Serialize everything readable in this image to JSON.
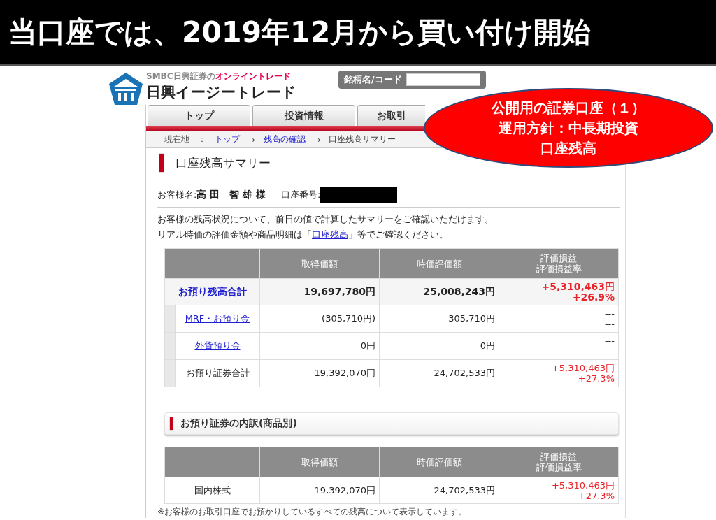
{
  "banner": {
    "title": "当口座では、2019年12月から買い付け開始"
  },
  "header": {
    "tagline_prefix": "SMBC日興証券の",
    "tagline_accent": "オンライントレード",
    "brand": "日興イージートレード",
    "search": {
      "label": "銘柄名/コード"
    }
  },
  "tabs": [
    {
      "label": "トップ"
    },
    {
      "label": "投資情報"
    },
    {
      "label": "お取引"
    }
  ],
  "breadcrumb": {
    "label": "現在地",
    "separator": "：",
    "arrow": "→",
    "items": [
      {
        "text": "トップ",
        "link": true
      },
      {
        "text": "残高の確認",
        "link": true
      },
      {
        "text": "口座残高サマリー",
        "link": false
      }
    ]
  },
  "page_title": "口座残高サマリー",
  "customer": {
    "name_label": "お客様名:",
    "name": "高 田　智 雄 様",
    "account_label": "口座番号:"
  },
  "intro": {
    "line1": "お客様の残高状況について、前日の値で計算したサマリーをご確認いただけます。",
    "line2_before": "リアル時価の評価金額や商品明細は「",
    "line2_link": "口座残高",
    "line2_after": "」等でご確認ください。"
  },
  "summary_table": {
    "columns": [
      [
        "取得価額"
      ],
      [
        "時価評価額"
      ],
      [
        "評価損益",
        "評価損益率"
      ]
    ],
    "rows": [
      {
        "kind": "total",
        "label": "お預り残高合計",
        "link": true,
        "cost": "19,697,780円",
        "value": "25,008,243円",
        "gain": "+5,310,463円",
        "rate": "+26.9%",
        "profit": true
      },
      {
        "kind": "sub",
        "label": "MRF・お預り金",
        "link": true,
        "cost": "(305,710円)",
        "value": "305,710円",
        "gain": "---",
        "rate": "---",
        "profit": false
      },
      {
        "kind": "sub",
        "label": "外貨預り金",
        "link": true,
        "cost": "0円",
        "value": "0円",
        "gain": "---",
        "rate": "---",
        "profit": false
      },
      {
        "kind": "sub",
        "label": "お預り証券合計",
        "link": false,
        "cost": "19,392,070円",
        "value": "24,702,533円",
        "gain": "+5,310,463円",
        "rate": "+27.3%",
        "profit": true
      }
    ]
  },
  "section_title": "お預り証券の内訳(商品別)",
  "breakdown_table": {
    "columns": [
      [
        "取得価額"
      ],
      [
        "時価評価額"
      ],
      [
        "評価損益",
        "評価損益率"
      ]
    ],
    "rows": [
      {
        "kind": "plain",
        "label": "国内株式",
        "link": false,
        "cost": "19,392,070円",
        "value": "24,702,533円",
        "gain": "+5,310,463円",
        "rate": "+27.3%",
        "profit": true
      }
    ]
  },
  "footnote": "※お客様のお取引口座でお預かりしているすべての残高について表示しています。",
  "overlay": {
    "lines": [
      "公開用の証券口座（１）",
      "運用方針：中長期投資",
      "口座残高"
    ]
  }
}
